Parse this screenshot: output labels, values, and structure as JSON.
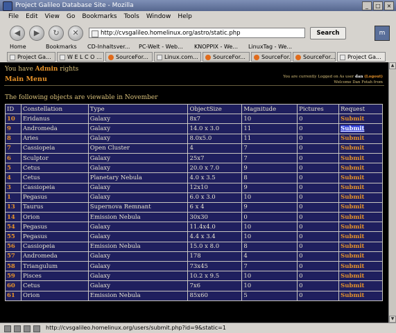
{
  "window": {
    "title": "Project Galileo Database Site - Mozilla"
  },
  "menu": [
    "File",
    "Edit",
    "View",
    "Go",
    "Bookmarks",
    "Tools",
    "Window",
    "Help"
  ],
  "nav": {
    "url": "http://cvsgalileo.homelinux.org/astro/static.php",
    "search_label": "Search"
  },
  "bookmarks": [
    "Home",
    "Bookmarks",
    "CD-Inhaltsver...",
    "PC-Welt - Web...",
    "KNOPPIX - We...",
    "LinuxTag - We..."
  ],
  "tabs": [
    "Project Ga...",
    "W E L C O ...",
    "SourceFor...",
    "Linux.com...",
    "SourceFor...",
    "SourceFor...",
    "SourceFor...",
    "Project Ga..."
  ],
  "page": {
    "rights_pre": "You have ",
    "rights_bold": "Admin",
    "rights_post": " rights",
    "main_menu": "Main Menu",
    "login_pre": "You are currently Logged on As user ",
    "login_user": "dan",
    "login_logout": "(Logout)",
    "login_welcome": "Welcome Dan Fotah from",
    "intro": "The following objects are viewable in November",
    "headers": [
      "ID",
      "Constellation",
      "Type",
      "ObjectSize",
      "Magnitude",
      "Pictures",
      "Request"
    ],
    "rows": [
      [
        "10",
        "Eridanus",
        "Galaxy",
        "8x7",
        "10",
        "0",
        "Submit"
      ],
      [
        "9",
        "Andromeda",
        "Galaxy",
        "14.0 x 3.0",
        "11",
        "0",
        "Submit"
      ],
      [
        "8",
        "Aries",
        "Galaxy",
        "8.0x5.0",
        "11",
        "0",
        "Submit"
      ],
      [
        "7",
        "Cassiopeia",
        "Open Cluster",
        "4",
        "7",
        "0",
        "Submit"
      ],
      [
        "6",
        "Sculptor",
        "Galaxy",
        "25x7",
        "7",
        "0",
        "Submit"
      ],
      [
        "5",
        "Cetus",
        "Galaxy",
        "20.0 x 7.0",
        "9",
        "0",
        "Submit"
      ],
      [
        "4",
        "Cetus",
        "Planetary Nebula",
        "4.0 x 3.5",
        "8",
        "0",
        "Submit"
      ],
      [
        "3",
        "Cassiopeia",
        "Galaxy",
        "12x10",
        "9",
        "0",
        "Submit"
      ],
      [
        "1",
        "Pegasus",
        "Galaxy",
        "6.0 x 3.0",
        "10",
        "0",
        "Submit"
      ],
      [
        "13",
        "Taurus",
        "Supernova Remnant",
        "6 x 4",
        "9",
        "0",
        "Submit"
      ],
      [
        "14",
        "Orion",
        "Emission Nebula",
        "30x30",
        "0",
        "0",
        "Submit"
      ],
      [
        "54",
        "Pegasus",
        "Galaxy",
        "11.4x4.0",
        "10",
        "0",
        "Submit"
      ],
      [
        "55",
        "Pegasus",
        "Galaxy",
        "4.4 x 3.4",
        "10",
        "0",
        "Submit"
      ],
      [
        "56",
        "Cassiopeia",
        "Emission Nebula",
        "15.0 x 8.0",
        "8",
        "0",
        "Submit"
      ],
      [
        "57",
        "Andromeda",
        "Galaxy",
        "178",
        "4",
        "0",
        "Submit"
      ],
      [
        "58",
        "Triangulum",
        "Galaxy",
        "73x45",
        "7",
        "0",
        "Submit"
      ],
      [
        "59",
        "Pisces",
        "Galaxy",
        "10.2 x 9.5",
        "10",
        "0",
        "Submit"
      ],
      [
        "60",
        "Cetus",
        "Galaxy",
        "7x6",
        "10",
        "0",
        "Submit"
      ],
      [
        "61",
        "Orion",
        "Emission Nebula",
        "85x60",
        "5",
        "0",
        "Submit"
      ]
    ]
  },
  "status": {
    "text": "http://cvsgalileo.homelinux.org/users/submit.php?id=9&static=1"
  },
  "colors": {
    "page_bg": "#000000",
    "table_bg": "#1f1f5e",
    "accent": "#e5922a",
    "highlight": "#3040d8"
  }
}
